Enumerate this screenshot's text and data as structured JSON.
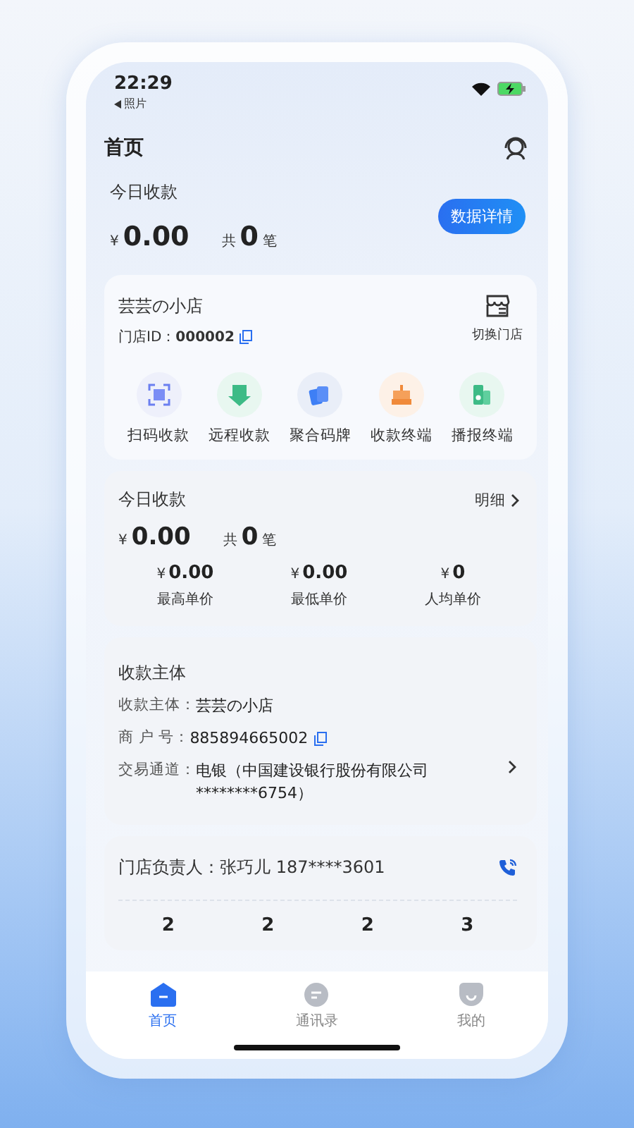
{
  "status_bar": {
    "time": "22:29",
    "back_label": "照片"
  },
  "header": {
    "title": "首页"
  },
  "summary": {
    "title": "今日收款",
    "currency": "¥",
    "amount": "0.00",
    "count_prefix": "共",
    "count": "0",
    "count_suffix": "笔",
    "button": "数据详情"
  },
  "store": {
    "name": "芸芸の小店",
    "id_label": "门店ID：",
    "id": "000002",
    "switch_label": "切换门店",
    "actions": [
      {
        "kind": "scan",
        "label": "扫码收款"
      },
      {
        "kind": "remote",
        "label": "远程收款"
      },
      {
        "kind": "cards",
        "label": "聚合码牌"
      },
      {
        "kind": "register",
        "label": "收款终端"
      },
      {
        "kind": "speaker",
        "label": "播报终端"
      }
    ]
  },
  "today": {
    "title": "今日收款",
    "link": "明细",
    "currency": "¥",
    "amount": "0.00",
    "count_prefix": "共",
    "count": "0",
    "count_suffix": "笔",
    "stats": [
      {
        "currency": "¥",
        "value": "0.00",
        "label": "最高单价"
      },
      {
        "currency": "¥",
        "value": "0.00",
        "label": "最低单价"
      },
      {
        "currency": "¥",
        "value": "0",
        "label": "人均单价"
      }
    ]
  },
  "subject": {
    "title": "收款主体",
    "rows": [
      {
        "kind": "text",
        "label": "收款主体：",
        "value": "芸芸の小店"
      },
      {
        "kind": "copy",
        "label": "商 户 号：",
        "value": "885894665002"
      },
      {
        "kind": "link",
        "label": "交易通道：",
        "value": "电银（中国建设银行股份有限公司 ********6754）"
      }
    ]
  },
  "manager": {
    "text": "门店负责人：张巧儿 187****3601",
    "counts": [
      "2",
      "2",
      "2",
      "3"
    ]
  },
  "tabs": [
    {
      "kind": "home",
      "label": "首页",
      "selected": true
    },
    {
      "kind": "contacts",
      "label": "通讯录",
      "selected": false
    },
    {
      "kind": "me",
      "label": "我的",
      "selected": false
    }
  ]
}
